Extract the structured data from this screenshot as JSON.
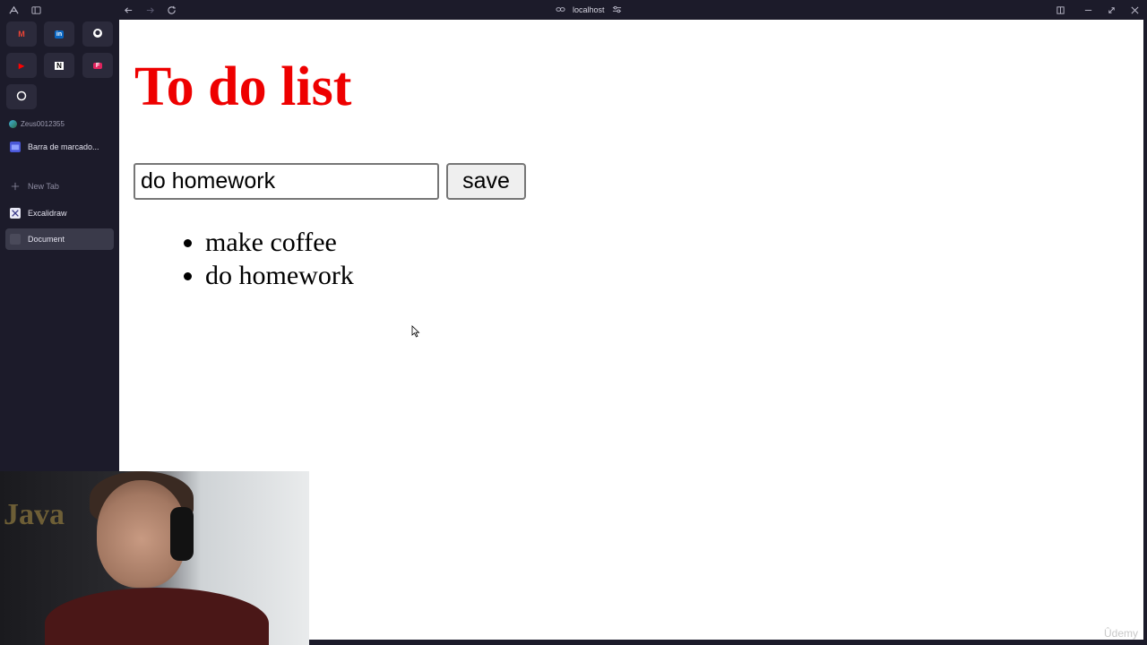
{
  "browser": {
    "address": "localhost",
    "favorites": [
      {
        "name": "gmail-favorite",
        "glyph": "M",
        "color": "#ea4335",
        "icon": "mail-icon"
      },
      {
        "name": "linkedin-favorite",
        "glyph": "in",
        "color": "#0a66c2",
        "icon": "linkedin-icon"
      },
      {
        "name": "github-favorite",
        "glyph": "",
        "color": "#ffffff",
        "icon": "github-icon"
      },
      {
        "name": "youtube-favorite",
        "glyph": "▶",
        "color": "#ff0000",
        "icon": "youtube-icon"
      },
      {
        "name": "notion-favorite",
        "glyph": "N",
        "color": "#ffffff",
        "icon": "notion-icon"
      },
      {
        "name": "figma-favorite",
        "glyph": "F",
        "color": "#e0245e",
        "icon": "app-icon"
      },
      {
        "name": "chatgpt-favorite",
        "glyph": "",
        "color": "#ffffff",
        "icon": "openai-icon"
      }
    ],
    "profile": "Zeus0012355",
    "bookmarks_folder": "Barra de marcado...",
    "new_tab": "New Tab",
    "tabs": [
      {
        "label": "Excalidraw",
        "active": false
      },
      {
        "label": "Document",
        "active": true
      }
    ]
  },
  "page": {
    "title": "To do list",
    "title_color": "#ee0000",
    "input_value": "do homework",
    "save_label": "save",
    "items": [
      "make coffee",
      "do homework"
    ]
  },
  "webcam": {
    "wall_text": "Java"
  },
  "watermark": "Ûdemy"
}
